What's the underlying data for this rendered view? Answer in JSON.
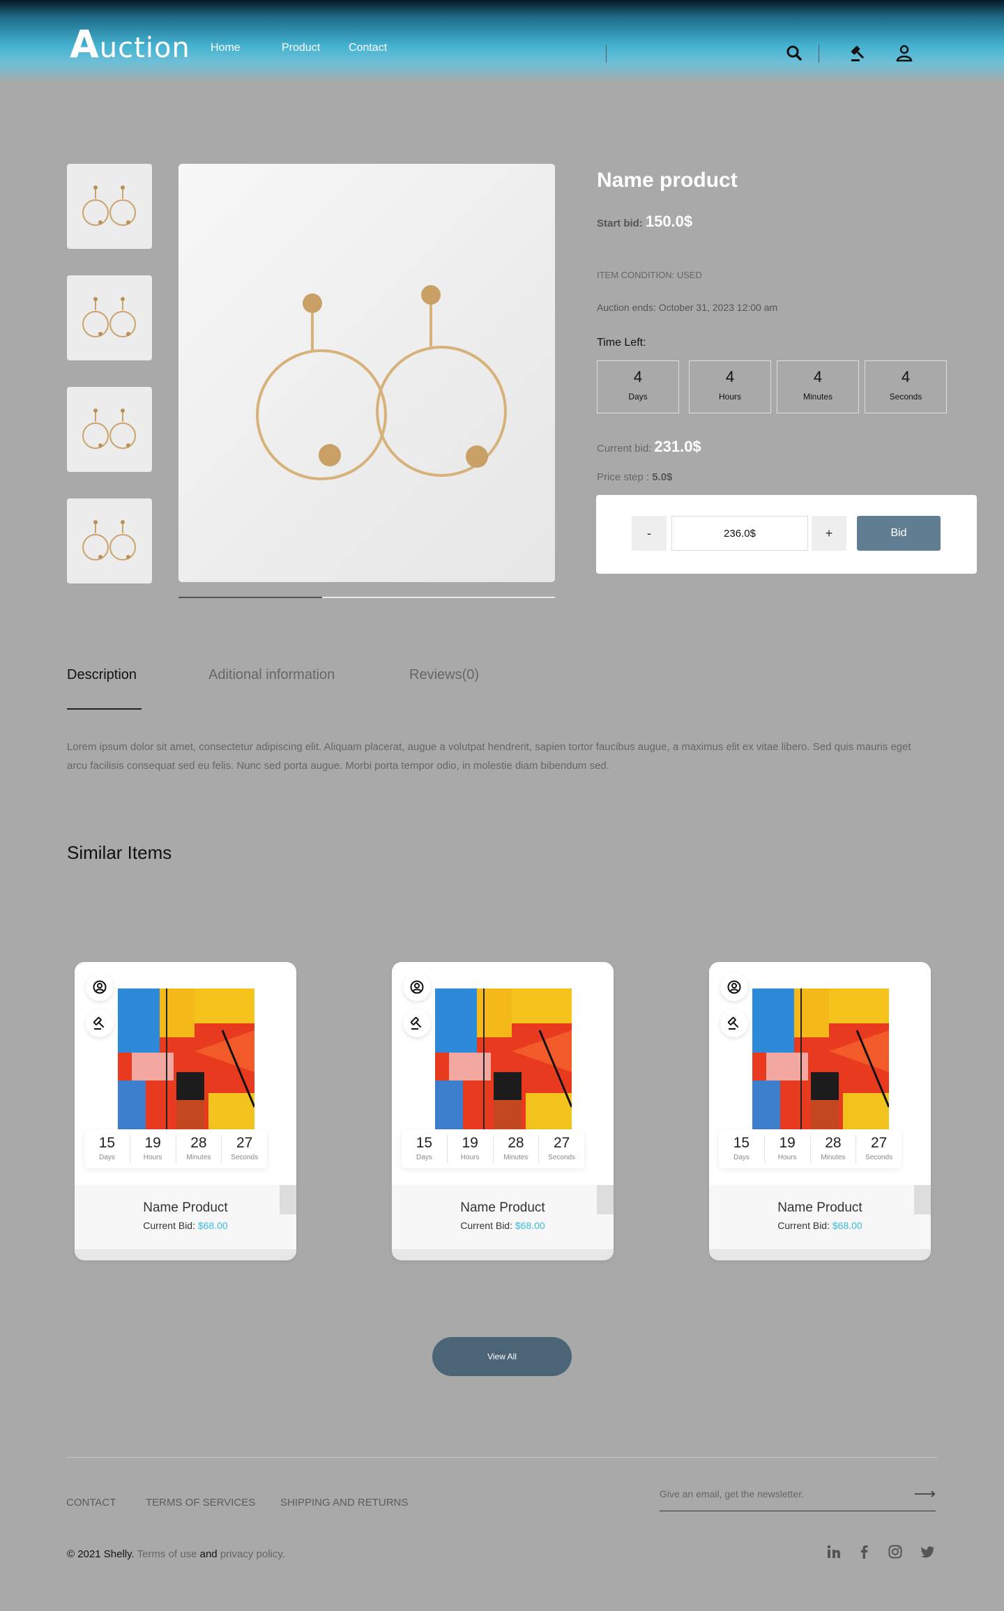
{
  "header": {
    "logo_initial": "A",
    "logo_rest": "uction",
    "nav": [
      "Home",
      "Product",
      "Contact"
    ]
  },
  "product": {
    "name": "Name product",
    "start_bid_label": "Start bid:",
    "start_bid_value": "150.0$",
    "condition": "ITEM CONDITION: USED",
    "auction_ends": "Auction ends: October 31, 2023 12:00 am",
    "time_left_label": "Time Left:",
    "time_left": [
      {
        "value": "4",
        "label": "Days"
      },
      {
        "value": "4",
        "label": "Hours"
      },
      {
        "value": "4",
        "label": "Minutes"
      },
      {
        "value": "4",
        "label": "Seconds"
      }
    ],
    "current_bid_label": "Current bid:",
    "current_bid_value": "231.0$",
    "price_step_label": "Price step :",
    "price_step_value": "5.0$",
    "bid_amount": "236.0$",
    "minus_label": "-",
    "plus_label": "+",
    "bid_button": "Bid"
  },
  "tabs": [
    {
      "label": "Description",
      "active": true
    },
    {
      "label": "Aditional information",
      "active": false
    },
    {
      "label": "Reviews(0)",
      "active": false
    }
  ],
  "description": "Lorem ipsum dolor sit amet, consectetur adipiscing elit. Aliquam placerat, augue a volutpat hendrerit, sapien tortor faucibus augue, a maximus elit ex vitae libero. Sed quis mauris eget arcu facilisis consequat sed eu felis. Nunc sed porta augue. Morbi porta tempor odio, in molestie diam bibendum sed.",
  "similar": {
    "title": "Similar Items",
    "cards": [
      {
        "timer": [
          {
            "value": "15",
            "label": "Days"
          },
          {
            "value": "19",
            "label": "Hours"
          },
          {
            "value": "28",
            "label": "Minutes"
          },
          {
            "value": "27",
            "label": "Seconds"
          }
        ],
        "name": "Name Product",
        "bid_label": "Current Bid:",
        "bid_value": "$68.00"
      },
      {
        "timer": [
          {
            "value": "15",
            "label": "Days"
          },
          {
            "value": "19",
            "label": "Hours"
          },
          {
            "value": "28",
            "label": "Minutes"
          },
          {
            "value": "27",
            "label": "Seconds"
          }
        ],
        "name": "Name Product",
        "bid_label": "Current Bid:",
        "bid_value": "$68.00"
      },
      {
        "timer": [
          {
            "value": "15",
            "label": "Days"
          },
          {
            "value": "19",
            "label": "Hours"
          },
          {
            "value": "28",
            "label": "Minutes"
          },
          {
            "value": "27",
            "label": "Seconds"
          }
        ],
        "name": "Name Product",
        "bid_label": "Current Bid:",
        "bid_value": "$68.00"
      }
    ],
    "view_all": "View All"
  },
  "footer": {
    "links": [
      "CONTACT",
      "TERMS OF SERVICES",
      "SHIPPING AND RETURNS"
    ],
    "newsletter_placeholder": "Give an email, get the newsletter.",
    "copyright": "© 2021 Shelly.",
    "terms": "Terms of use",
    "and": "and",
    "privacy": "privacy policy.",
    "social_icons": [
      "linkedin-icon",
      "facebook-icon",
      "instagram-icon",
      "twitter-icon"
    ]
  },
  "colors": {
    "accent": "#37bde0",
    "bid_button": "#607d92",
    "view_all": "#4b6577",
    "page_bg": "#a9a9a9"
  }
}
